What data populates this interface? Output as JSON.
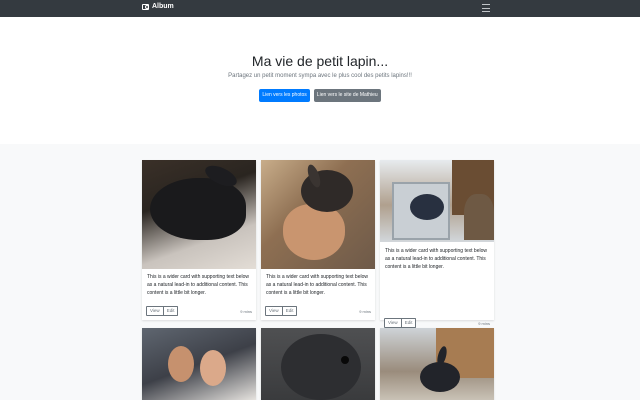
{
  "navbar": {
    "brand": "Album",
    "brand_icon": "camera-icon",
    "toggler_icon": "menu-icon"
  },
  "hero": {
    "title": "Ma vie de petit lapin...",
    "lead": "Partagez un petit moment sympa avec le plus cool des petits lapins!!!",
    "primary_button": "Lien vers les photos",
    "secondary_button": "Lien vers le site de Mathieu"
  },
  "cards": [
    {
      "text": "This is a wider card with supporting text below as a natural lead-in to additional content. This content is a little bit longer.",
      "view_label": "View",
      "edit_label": "Edit",
      "time": "9 mins"
    },
    {
      "text": "This is a wider card with supporting text below as a natural lead-in to additional content. This content is a little bit longer.",
      "view_label": "View",
      "edit_label": "Edit",
      "time": "9 mins"
    },
    {
      "text": "This is a wider card with supporting text below as a natural lead-in to additional content. This content is a little bit longer.",
      "view_label": "View",
      "edit_label": "Edit",
      "time": "9 mins"
    }
  ],
  "colors": {
    "navbar": "#343a40",
    "primary": "#007bff",
    "secondary": "#6c757d",
    "album_background": "#f8f9fa"
  }
}
